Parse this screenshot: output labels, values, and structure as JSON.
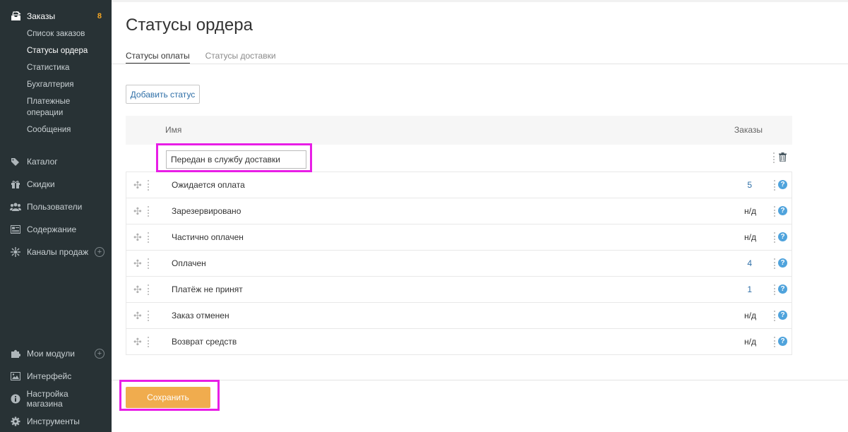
{
  "sidebar": {
    "orders": {
      "label": "Заказы",
      "badge": "8",
      "icon": "orders-tray-icon"
    },
    "sub_items": [
      {
        "label": "Список заказов",
        "active": false
      },
      {
        "label": "Статусы ордера",
        "active": true
      },
      {
        "label": "Статистика",
        "active": false
      },
      {
        "label": "Бухгалтерия",
        "active": false
      },
      {
        "label": "Платежные операции",
        "active": false
      },
      {
        "label": "Сообщения",
        "active": false
      }
    ],
    "items": [
      {
        "label": "Каталог",
        "icon": "tags-icon"
      },
      {
        "label": "Скидки",
        "icon": "gift-icon"
      },
      {
        "label": "Пользователи",
        "icon": "users-icon"
      },
      {
        "label": "Содержание",
        "icon": "content-icon"
      },
      {
        "label": "Каналы продаж",
        "icon": "sales-channels-icon",
        "plus": true
      }
    ],
    "bottom_items": [
      {
        "label": "Мои модули",
        "icon": "puzzle-icon",
        "plus": true
      },
      {
        "label": "Интерфейс",
        "icon": "image-icon"
      },
      {
        "label": "Настройка магазина",
        "icon": "info-icon"
      },
      {
        "label": "Инструменты",
        "icon": "gear-icon"
      }
    ]
  },
  "page": {
    "title": "Статусы ордера",
    "tabs": [
      {
        "label": "Статусы оплаты",
        "active": true
      },
      {
        "label": "Статусы доставки",
        "active": false
      }
    ],
    "add_button": "Добавить статус",
    "save_button": "Сохранить"
  },
  "table": {
    "columns": {
      "name": "Имя",
      "orders": "Заказы"
    },
    "new_row_value": "Передан в службу доставки",
    "rows": [
      {
        "name": "Ожидается оплата",
        "orders": "5",
        "link": true
      },
      {
        "name": "Зарезервировано",
        "orders": "н/д",
        "link": false
      },
      {
        "name": "Частично оплачен",
        "orders": "н/д",
        "link": false
      },
      {
        "name": "Оплачен",
        "orders": "4",
        "link": true
      },
      {
        "name": "Платёж не принят",
        "orders": "1",
        "link": true
      },
      {
        "name": "Заказ отменен",
        "orders": "н/д",
        "link": false
      },
      {
        "name": "Возврат средств",
        "orders": "н/д",
        "link": false
      }
    ]
  },
  "colors": {
    "sidebar_bg": "#283235",
    "accent_save": "#f0ac4e",
    "link": "#2f6fa7",
    "highlight": "#e81ee6",
    "help_icon": "#4fa3dc"
  }
}
